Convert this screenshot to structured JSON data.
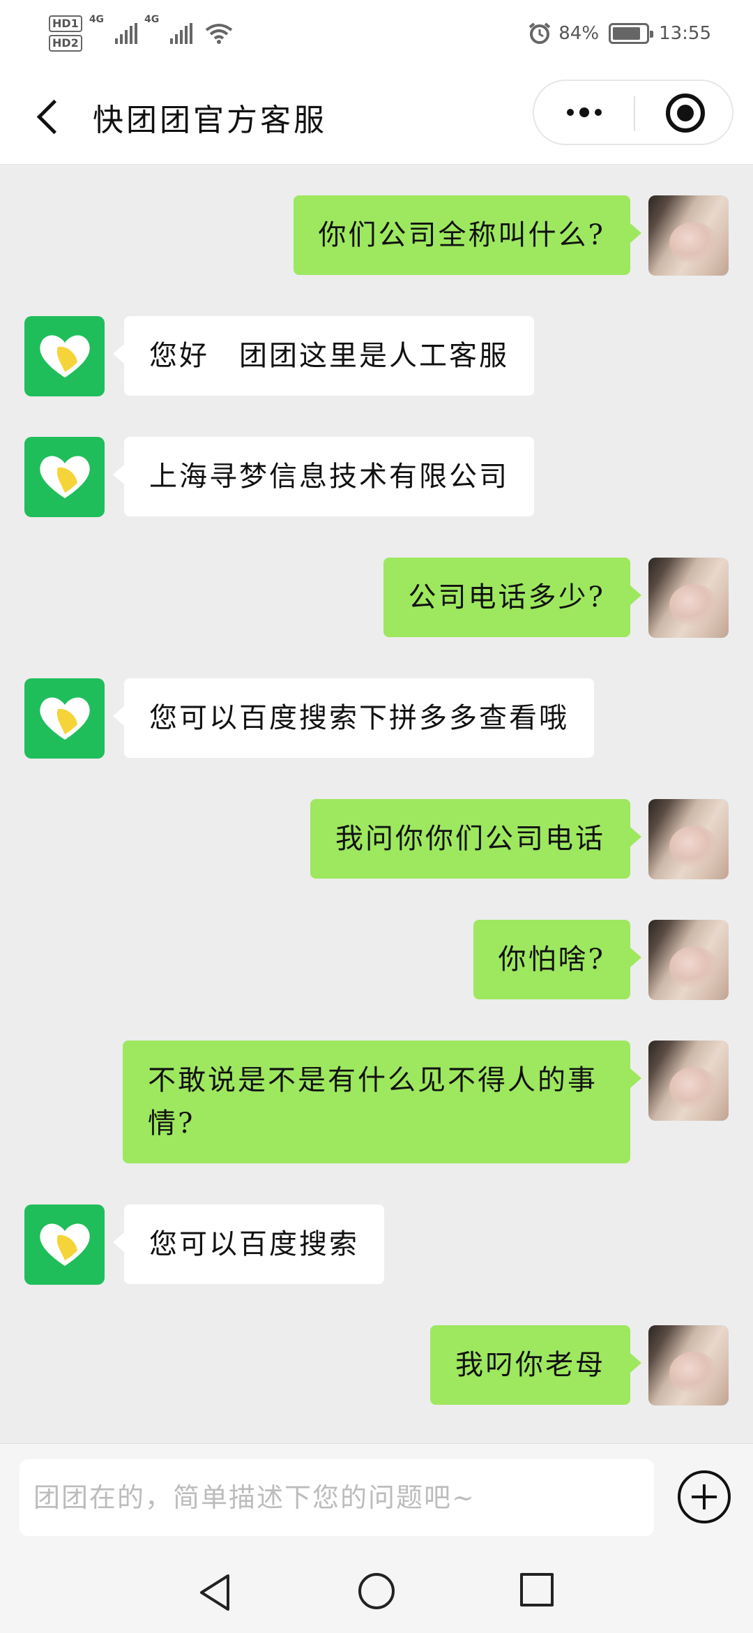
{
  "status_bar": {
    "hd1": "HD1",
    "hd2": "HD2",
    "net1": "4G",
    "net2": "4G",
    "battery_text": "84%",
    "battery_level": 0.84,
    "time": "13:55"
  },
  "header": {
    "title": "快团团官方客服"
  },
  "messages": [
    {
      "side": "out",
      "text": "你们公司全称叫什么?"
    },
    {
      "side": "in",
      "text": "您好　团团这里是人工客服"
    },
    {
      "side": "in",
      "text": "上海寻梦信息技术有限公司"
    },
    {
      "side": "out",
      "text": "公司电话多少?"
    },
    {
      "side": "in",
      "text": "您可以百度搜索下拼多多查看哦"
    },
    {
      "side": "out",
      "text": "我问你你们公司电话"
    },
    {
      "side": "out",
      "text": "你怕啥?"
    },
    {
      "side": "out",
      "text": "不敢说是不是有什么见不得人的事情?"
    },
    {
      "side": "in",
      "text": "您可以百度搜索"
    },
    {
      "side": "out",
      "text": "我叼你老母"
    }
  ],
  "input": {
    "placeholder": "团团在的，简单描述下您的问题吧~",
    "value": ""
  },
  "colors": {
    "bot_avatar": "#1fbe5a",
    "out_bubble": "#9de85f",
    "in_bubble": "#ffffff",
    "chat_bg": "#ededed"
  },
  "icons": {
    "back": "back-arrow-icon",
    "more": "more-dots-icon",
    "close": "target-close-icon",
    "plus": "plus-circle-icon",
    "alarm": "alarm-icon",
    "wifi": "wifi-icon"
  }
}
